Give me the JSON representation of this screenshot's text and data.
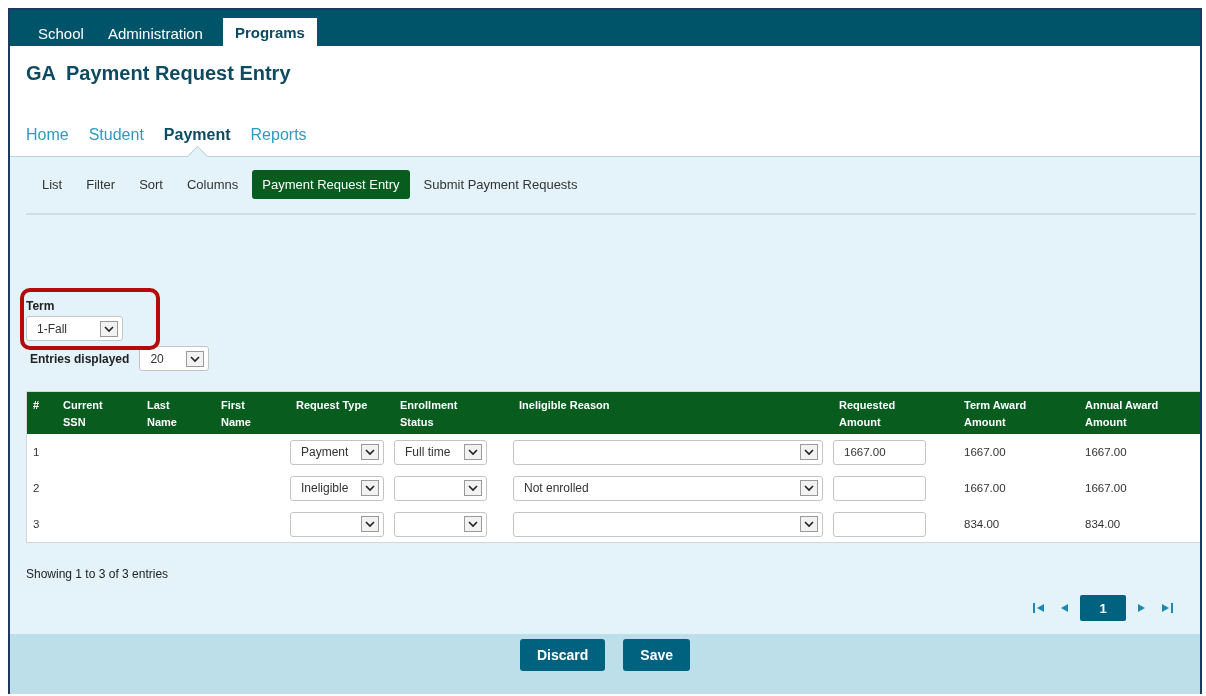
{
  "top_tabs": [
    {
      "label": "School",
      "selected": false
    },
    {
      "label": "Administration",
      "selected": false
    },
    {
      "label": "Programs",
      "selected": true
    }
  ],
  "page_title": {
    "prefix": "GA",
    "title": "Payment Request Entry"
  },
  "nav": [
    {
      "label": "Home",
      "selected": false
    },
    {
      "label": "Student",
      "selected": false
    },
    {
      "label": "Payment",
      "selected": true
    },
    {
      "label": "Reports",
      "selected": false
    }
  ],
  "subnav": [
    {
      "label": "List",
      "selected": false
    },
    {
      "label": "Filter",
      "selected": false
    },
    {
      "label": "Sort",
      "selected": false
    },
    {
      "label": "Columns",
      "selected": false
    },
    {
      "label": "Payment Request Entry",
      "selected": true
    },
    {
      "label": "Submit Payment Requests",
      "selected": false
    }
  ],
  "term": {
    "label": "Term",
    "value": "1-Fall",
    "highlighted": true
  },
  "entries": {
    "label": "Entries displayed",
    "value": "20"
  },
  "table": {
    "columns": [
      "#",
      "Current SSN",
      "Last Name",
      "First Name",
      "Request Type",
      "Enrollment Status",
      "Ineligible Reason",
      "Requested Amount",
      "Term Award Amount",
      "Annual Award Amount"
    ],
    "rows": [
      {
        "number": "1",
        "request_type": "Payment",
        "enrollment_status": "Full time",
        "requested_amount": "1667.00",
        "term_award": "1667.00",
        "annual_award": "1667.00"
      },
      {
        "number": "2",
        "request_type": "Ineligible",
        "ineligible_reason": "Not enrolled",
        "term_award": "1667.00",
        "annual_award": "1667.00"
      },
      {
        "number": "3",
        "term_award": "834.00",
        "annual_award": "834.00"
      }
    ]
  },
  "summary": "Showing 1 to 3 of 3 entries",
  "pagination": {
    "pages": [
      {
        "label": "1",
        "selected": true
      }
    ]
  },
  "buttons": [
    "Discard",
    "Save"
  ]
}
